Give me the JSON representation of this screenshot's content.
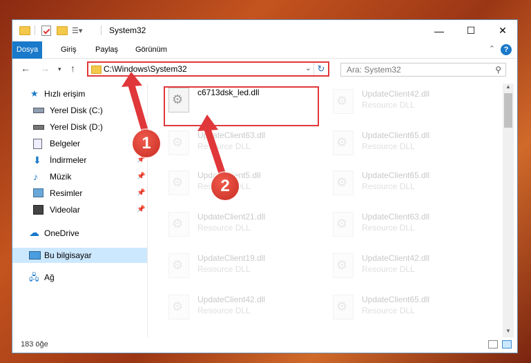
{
  "window": {
    "title": "System32"
  },
  "ribbon": {
    "tabs": [
      "Dosya",
      "Giriş",
      "Paylaş",
      "Görünüm"
    ]
  },
  "address": {
    "path": "C:\\Windows\\System32"
  },
  "search": {
    "placeholder": "Ara: System32"
  },
  "sidebar": {
    "items": [
      {
        "label": "Hızlı erişim",
        "icon": "star-icon",
        "pinned": false
      },
      {
        "label": "Yerel Disk (C:)",
        "icon": "drive-icon",
        "pinned": false
      },
      {
        "label": "Yerel Disk (D:)",
        "icon": "drive-icon",
        "pinned": false
      },
      {
        "label": "Belgeler",
        "icon": "document-icon",
        "pinned": false
      },
      {
        "label": "İndirmeler",
        "icon": "download-icon",
        "pinned": true
      },
      {
        "label": "Müzik",
        "icon": "music-icon",
        "pinned": true
      },
      {
        "label": "Resimler",
        "icon": "picture-icon",
        "pinned": true
      },
      {
        "label": "Videolar",
        "icon": "video-icon",
        "pinned": true
      },
      {
        "label": "OneDrive",
        "icon": "cloud-icon",
        "pinned": false
      },
      {
        "label": "Bu bilgisayar",
        "icon": "computer-icon",
        "pinned": false
      },
      {
        "label": "Ağ",
        "icon": "network-icon",
        "pinned": false
      }
    ]
  },
  "files": {
    "highlighted": {
      "name": "c6713dsk_led.dll"
    },
    "left": [
      {
        "name": "UpdateClient63.dll",
        "type": "Resource DLL"
      },
      {
        "name": "UpdateClient5.dll",
        "type": "Resource DLL"
      },
      {
        "name": "UpdateClient21.dll",
        "type": "Resource DLL"
      },
      {
        "name": "UpdateClient19.dll",
        "type": "Resource DLL"
      },
      {
        "name": "UpdateClient42.dll",
        "type": "Resource DLL"
      }
    ],
    "right": [
      {
        "name": "UpdateClient42.dll",
        "type": "Resource DLL"
      },
      {
        "name": "UpdateClient65.dll",
        "type": "Resource DLL"
      },
      {
        "name": "UpdateClient65.dll",
        "type": "Resource DLL"
      },
      {
        "name": "UpdateClient63.dll",
        "type": "Resource DLL"
      },
      {
        "name": "UpdateClient42.dll",
        "type": "Resource DLL"
      },
      {
        "name": "UpdateClient65.dll",
        "type": "Resource DLL"
      }
    ]
  },
  "status": {
    "item_count": "183 öğe"
  },
  "annotations": {
    "step1": "1",
    "step2": "2",
    "color": "#e0373a"
  }
}
